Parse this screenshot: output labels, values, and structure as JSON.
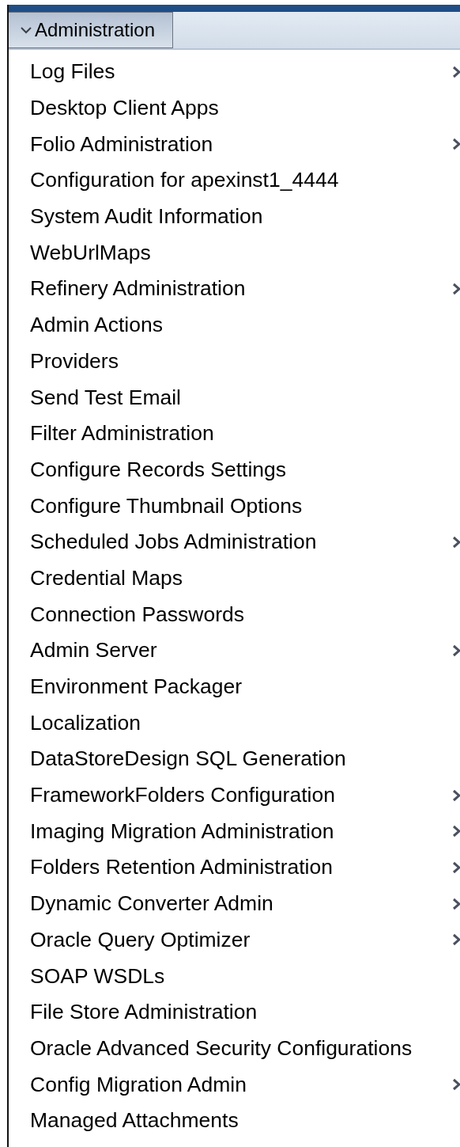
{
  "panel": {
    "title": "Administration",
    "expanded": true
  },
  "items": [
    {
      "label": "Log Files",
      "submenu": true
    },
    {
      "label": "Desktop Client Apps",
      "submenu": false
    },
    {
      "label": "Folio Administration",
      "submenu": true
    },
    {
      "label": "Configuration for apexinst1_4444",
      "submenu": false
    },
    {
      "label": "System Audit Information",
      "submenu": false
    },
    {
      "label": "WebUrlMaps",
      "submenu": false
    },
    {
      "label": "Refinery Administration",
      "submenu": true
    },
    {
      "label": "Admin Actions",
      "submenu": false
    },
    {
      "label": "Providers",
      "submenu": false
    },
    {
      "label": "Send Test Email",
      "submenu": false
    },
    {
      "label": "Filter Administration",
      "submenu": false
    },
    {
      "label": "Configure Records Settings",
      "submenu": false
    },
    {
      "label": "Configure Thumbnail Options",
      "submenu": false
    },
    {
      "label": "Scheduled Jobs Administration",
      "submenu": true
    },
    {
      "label": "Credential Maps",
      "submenu": false
    },
    {
      "label": "Connection Passwords",
      "submenu": false
    },
    {
      "label": "Admin Server",
      "submenu": true
    },
    {
      "label": "Environment Packager",
      "submenu": false
    },
    {
      "label": "Localization",
      "submenu": false
    },
    {
      "label": "DataStoreDesign SQL Generation",
      "submenu": false
    },
    {
      "label": "FrameworkFolders Configuration",
      "submenu": true
    },
    {
      "label": "Imaging Migration Administration",
      "submenu": true
    },
    {
      "label": "Folders Retention Administration",
      "submenu": true
    },
    {
      "label": "Dynamic Converter Admin",
      "submenu": true
    },
    {
      "label": "Oracle Query Optimizer",
      "submenu": true
    },
    {
      "label": "SOAP WSDLs",
      "submenu": false
    },
    {
      "label": "File Store Administration",
      "submenu": false
    },
    {
      "label": "Oracle Advanced Security Configurations",
      "submenu": false
    },
    {
      "label": "Config Migration Admin",
      "submenu": true
    },
    {
      "label": "Managed Attachments",
      "submenu": false
    }
  ]
}
